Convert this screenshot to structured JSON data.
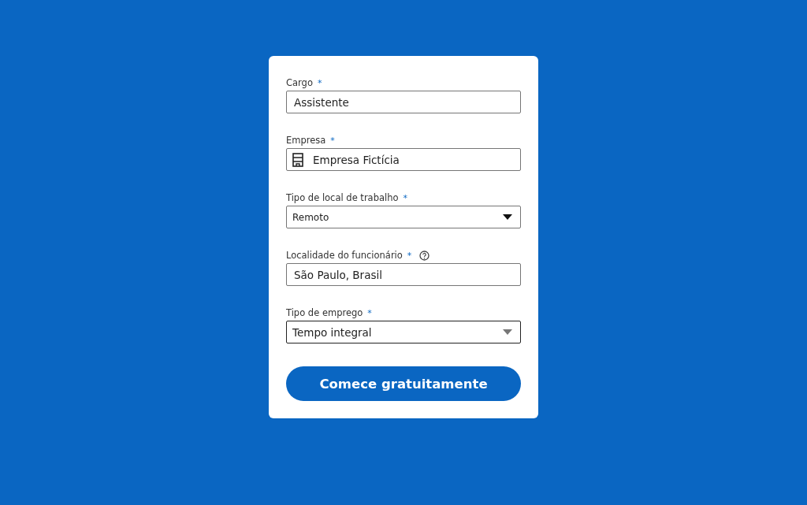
{
  "form": {
    "fields": [
      {
        "kind": "text",
        "label": "Cargo",
        "required_mark": "*",
        "value": "Assistente",
        "help": false,
        "focused": false
      },
      {
        "kind": "company",
        "label": "Empresa",
        "required_mark": "*",
        "value": "Empresa Fictícia",
        "help": false,
        "focused": false
      },
      {
        "kind": "select",
        "label": "Tipo de local de trabalho",
        "required_mark": "*",
        "value": "Remoto",
        "help": false,
        "focused": false
      },
      {
        "kind": "text",
        "label": "Localidade do funcionário",
        "required_mark": "*",
        "value": "São Paulo, Brasil",
        "help": true,
        "focused": false
      },
      {
        "kind": "select",
        "label": "Tipo de emprego",
        "required_mark": "*",
        "value": "Tempo integral",
        "help": false,
        "focused": true
      }
    ],
    "submit_button": "Comece gratuitamente"
  }
}
